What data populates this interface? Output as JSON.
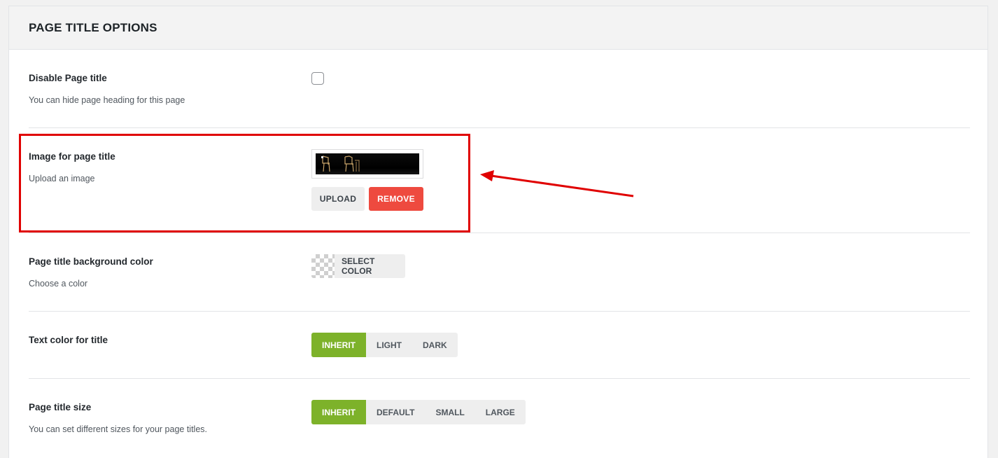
{
  "panel": {
    "title": "PAGE TITLE OPTIONS"
  },
  "rows": {
    "disable_title": {
      "label": "Disable Page title",
      "desc": "You can hide page heading for this page",
      "checked": false
    },
    "image": {
      "label": "Image for page title",
      "desc": "Upload an image",
      "upload_label": "UPLOAD",
      "remove_label": "REMOVE"
    },
    "bg_color": {
      "label": "Page title background color",
      "desc": "Choose a color",
      "select_label": "SELECT COLOR"
    },
    "text_color": {
      "label": "Text color for title",
      "options": [
        "INHERIT",
        "LIGHT",
        "DARK"
      ],
      "selected": "INHERIT"
    },
    "title_size": {
      "label": "Page title size",
      "desc": "You can set different sizes for your page titles.",
      "options": [
        "INHERIT",
        "DEFAULT",
        "SMALL",
        "LARGE"
      ],
      "selected": "INHERIT"
    }
  },
  "colors": {
    "accent_green": "#7db22a",
    "remove_red": "#ee4a3f",
    "highlight_red": "#e00000"
  }
}
